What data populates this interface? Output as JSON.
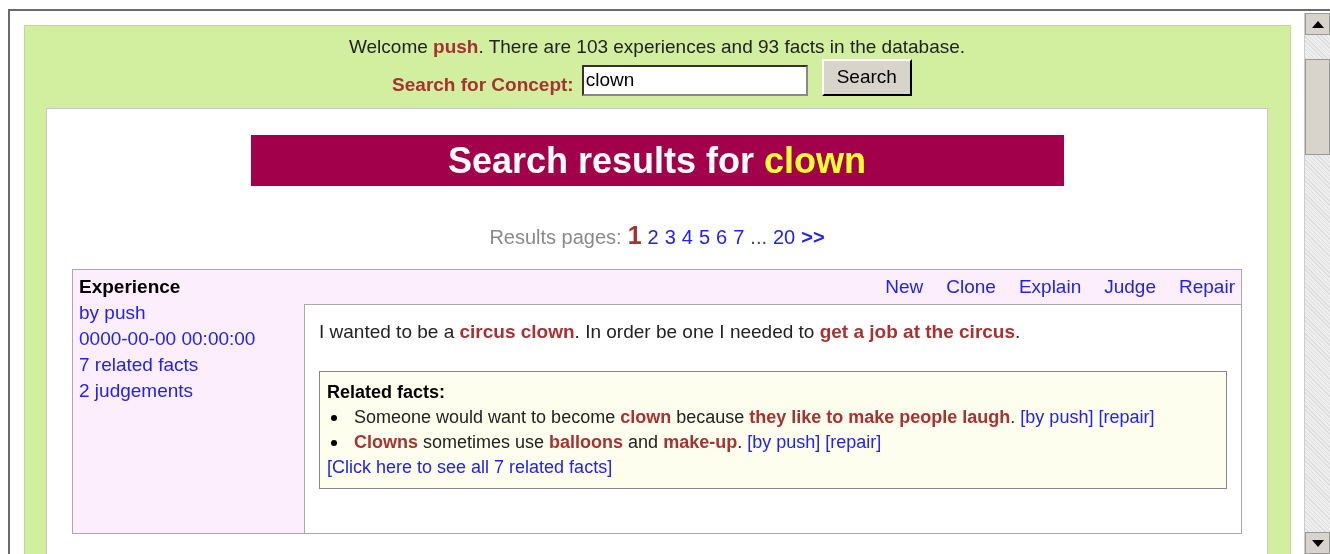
{
  "welcome": "Welcome **push**. There are 103 experiences and 93 facts in the database.",
  "search": {
    "label": "Search for Concept:",
    "value": "clown",
    "button": "Search"
  },
  "results": {
    "title": "Search results for",
    "query": "clown"
  },
  "pagination": {
    "label": "Results pages:",
    "items": [
      {
        "kind": "page",
        "label": "1",
        "selected": true
      },
      {
        "kind": "page",
        "label": "2",
        "selected": false
      },
      {
        "kind": "page",
        "label": "3",
        "selected": false
      },
      {
        "kind": "page",
        "label": "4",
        "selected": false
      },
      {
        "kind": "page",
        "label": "5",
        "selected": false
      },
      {
        "kind": "page",
        "label": "6",
        "selected": false
      },
      {
        "kind": "page",
        "label": "7",
        "selected": false
      },
      {
        "kind": "ellipsis",
        "label": "..."
      },
      {
        "kind": "page",
        "label": "20",
        "selected": false
      },
      {
        "kind": "next",
        "label": ">>"
      }
    ]
  },
  "experience": {
    "heading": "Experience",
    "actions": [
      "New",
      "Clone",
      "Explain",
      "Judge",
      "Repair"
    ],
    "meta": [
      "by push",
      "0000-00-00 00:00:00",
      "7 related facts",
      "2 judgements"
    ],
    "text": "I wanted to be a **circus clown**. In order be one I needed to **get a job at the circus**.",
    "related": {
      "heading": "Related facts:",
      "facts": [
        {
          "text": "Someone would want to become **clown** because **they like to make people laugh**.",
          "links": [
            "[by push]",
            "[repair]"
          ]
        },
        {
          "text": "**Clowns** sometimes use **balloons** and **make-up**.",
          "links": [
            "[by push]",
            "[repair]"
          ]
        }
      ],
      "more": "[Click here to see all 7 related facts]"
    }
  }
}
